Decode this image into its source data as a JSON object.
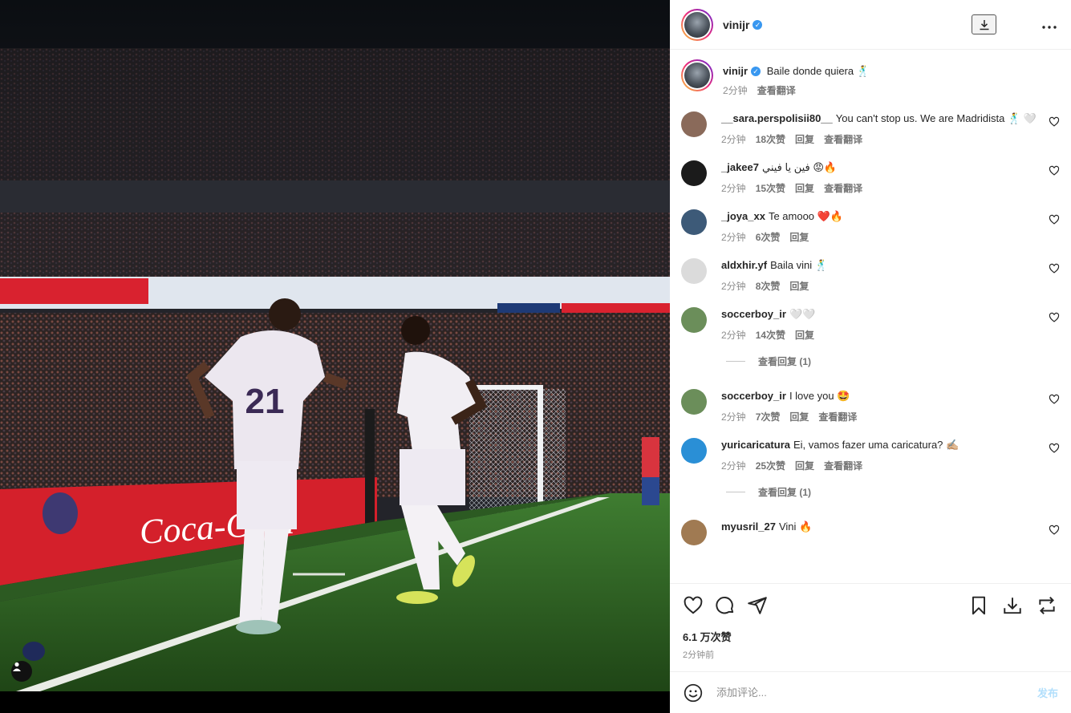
{
  "post": {
    "username": "vinijr",
    "verified_glyph": "✓",
    "caption": "Baile donde quiera 🕺",
    "caption_time": "2分钟",
    "caption_translate": "查看翻译"
  },
  "header": {
    "download_icon": "download-icon",
    "more_icon": "more-icon",
    "more_label": "•••"
  },
  "comments": [
    {
      "user": "__sara.perspolisii80__",
      "text": "You can't stop us. We are Madridista 🕺 🤍",
      "time": "2分钟",
      "likes": "18次赞",
      "reply": "回复",
      "translate": "查看翻译",
      "avatar_color": "#8a6a5a"
    },
    {
      "user": "_jakee7",
      "text": "فين يا فيني 😡🔥",
      "time": "2分钟",
      "likes": "15次赞",
      "reply": "回复",
      "translate": "查看翻译",
      "avatar_color": "#1b1b1b"
    },
    {
      "user": "_joya_xx",
      "text": "Te amooo ❤️🔥",
      "time": "2分钟",
      "likes": "6次赞",
      "reply": "回复",
      "translate": "",
      "avatar_color": "#3d5a78"
    },
    {
      "user": "aldxhir.yf",
      "text": "Baila vini 🕺",
      "time": "2分钟",
      "likes": "8次赞",
      "reply": "回复",
      "translate": "",
      "avatar_color": "#dbdbdb"
    },
    {
      "user": "soccerboy_ir",
      "text": "🤍🤍",
      "time": "2分钟",
      "likes": "14次赞",
      "reply": "回复",
      "translate": "",
      "avatar_color": "#6b8e5a",
      "view_replies": "查看回复 (1)"
    },
    {
      "user": "soccerboy_ir",
      "text": "I love you 🤩",
      "time": "2分钟",
      "likes": "7次赞",
      "reply": "回复",
      "translate": "查看翻译",
      "avatar_color": "#6b8e5a"
    },
    {
      "user": "yuricaricatura",
      "text": "Ei, vamos fazer uma caricatura? ✍🏼",
      "time": "2分钟",
      "likes": "25次赞",
      "reply": "回复",
      "translate": "查看翻译",
      "avatar_color": "#2a8fd6",
      "view_replies": "查看回复 (1)"
    },
    {
      "user": "myusril_27",
      "text": "Vini 🔥",
      "time": "",
      "likes": "",
      "reply": "",
      "translate": "",
      "avatar_color": "#a07a52"
    }
  ],
  "footer": {
    "likes": "6.1 万次赞",
    "posted": "2分钟前",
    "comment_placeholder": "添加评论...",
    "post_label": "发布"
  },
  "colors": {
    "verified": "#3897f0",
    "post_button": "#b2dffc",
    "secondary_text": "#8e8e8e"
  }
}
